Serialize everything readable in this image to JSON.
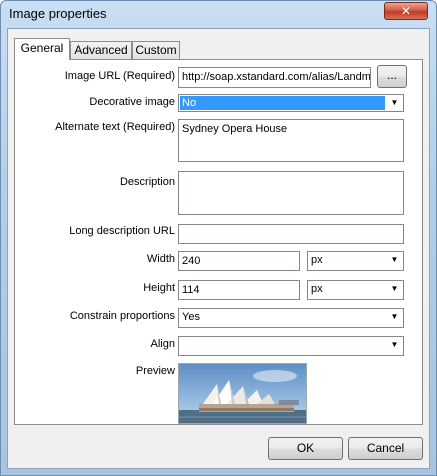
{
  "window": {
    "title": "Image properties",
    "close_label": "✕"
  },
  "tabs": [
    {
      "label": "General",
      "active": true
    },
    {
      "label": "Advanced",
      "active": false
    },
    {
      "label": "Custom",
      "active": false
    }
  ],
  "fields": {
    "image_url": {
      "label": "Image URL (Required)",
      "value": "http://soap.xstandard.com/alias/Landm",
      "browse_label": "..."
    },
    "decorative": {
      "label": "Decorative image",
      "value": "No"
    },
    "alt_text": {
      "label": "Alternate text (Required)",
      "value": "Sydney Opera House"
    },
    "description": {
      "label": "Description",
      "value": ""
    },
    "long_desc_url": {
      "label": "Long description URL",
      "value": ""
    },
    "width": {
      "label": "Width",
      "value": "240",
      "unit": "px"
    },
    "height": {
      "label": "Height",
      "value": "114",
      "unit": "px"
    },
    "constrain": {
      "label": "Constrain proportions",
      "value": "Yes"
    },
    "align": {
      "label": "Align",
      "value": ""
    },
    "preview": {
      "label": "Preview"
    }
  },
  "buttons": {
    "ok": "OK",
    "cancel": "Cancel"
  },
  "icons": {
    "dropdown": "chevron-down-icon",
    "close": "close-icon"
  },
  "colors": {
    "selection": "#3399ff",
    "close_button": "#c13a22"
  }
}
